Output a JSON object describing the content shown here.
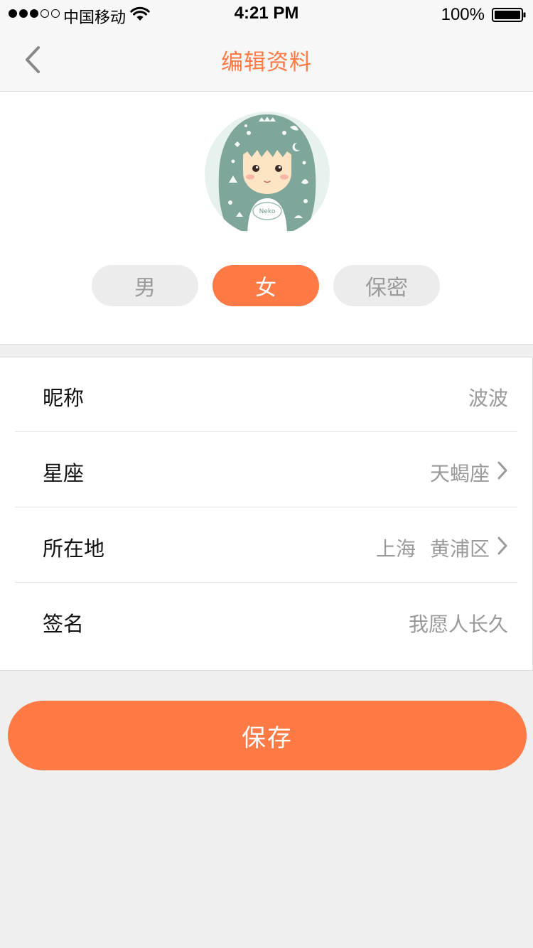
{
  "status_bar": {
    "carrier": "中国移动",
    "time": "4:21 PM",
    "battery": "100%",
    "signal_bars_filled": 3,
    "signal_bars_total": 5
  },
  "nav": {
    "title": "编辑资料",
    "back_icon": "chevron-left-icon"
  },
  "profile": {
    "avatar_label": "Neko",
    "gender_options": [
      "男",
      "女",
      "保密"
    ],
    "gender_selected": "女"
  },
  "fields": {
    "nickname": {
      "label": "昵称",
      "value": "波波"
    },
    "zodiac": {
      "label": "星座",
      "value": "天蝎座"
    },
    "location": {
      "label": "所在地",
      "city": "上海",
      "district": "黄浦区"
    },
    "signature": {
      "label": "签名",
      "value": "我愿人长久"
    }
  },
  "actions": {
    "save_label": "保存"
  },
  "colors": {
    "accent": "#ff7a45",
    "muted_text": "#9a9a9a",
    "background": "#efefef"
  }
}
